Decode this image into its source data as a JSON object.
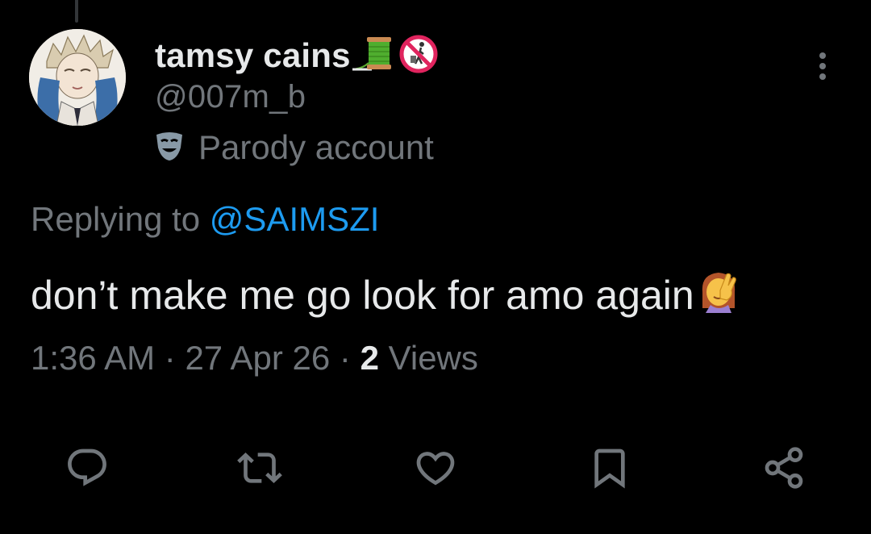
{
  "author": {
    "display_name": "tamsy cains",
    "name_emojis": [
      "thread-spool-icon",
      "no-littering-icon"
    ],
    "handle": "@007m_b",
    "parody_label": "Parody account"
  },
  "reply": {
    "prefix": "Replying to ",
    "mention": "@SAIMSZI"
  },
  "tweet": {
    "text": "don’t make me go look for amo again",
    "trailing_emoji": "face-palm-icon"
  },
  "meta": {
    "time": "1:36 AM",
    "separator": " · ",
    "date": "27 Apr 26",
    "views_count": "2",
    "views_label": " Views"
  },
  "actions": [
    "reply-icon",
    "retweet-icon",
    "like-icon",
    "bookmark-icon",
    "share-icon"
  ],
  "colors": {
    "background": "#000000",
    "primary_text": "#e7e9ea",
    "secondary_text": "#71767b",
    "link": "#1d9bf0"
  }
}
